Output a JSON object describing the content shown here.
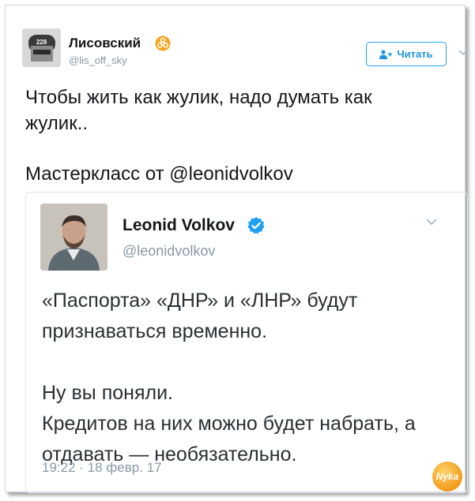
{
  "author": {
    "display_name": "Лисовский",
    "handle": "@lis_off_sky",
    "badge_icon": "biohazard-icon",
    "avatar_label": "228"
  },
  "follow_button": {
    "label": "Читать",
    "icon": "add-user-icon"
  },
  "tweet": {
    "line1": "Чтобы жить как жулик, надо думать как",
    "line2": "жулик..",
    "master_prefix": "Мастеркласс от ",
    "mention": "@leonidvolkov"
  },
  "quoted": {
    "display_name": "Leonid Volkov",
    "handle": "@leonidvolkov",
    "verified_icon": "verified-icon",
    "text_lines": [
      "«Паспорта» «ДНР» и «ЛНР» будут",
      "признаваться временно.",
      "",
      "Ну вы поняли.",
      "Кредитов на них можно будет набрать, а",
      "отдавать — необязательно."
    ],
    "timestamp": "19:22 · 18 февр. 17"
  },
  "watermark": {
    "text": "Nyka"
  },
  "colors": {
    "accent": "#1da1f2",
    "link": "#1b95e0",
    "muted": "#8899a6",
    "badge": "#f5a623"
  }
}
